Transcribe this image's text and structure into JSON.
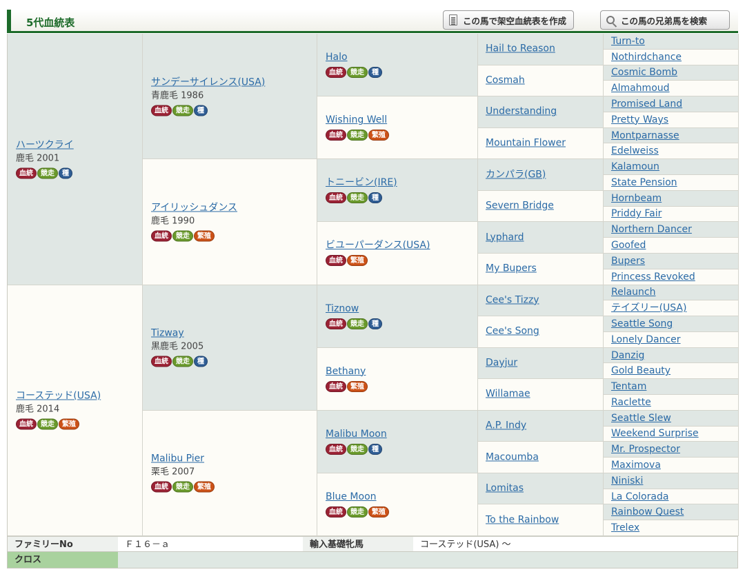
{
  "header": {
    "title": "5代血統表",
    "btn_fictional": "この馬で架空血統表を作成",
    "btn_siblings": "この馬の兄弟馬を検索"
  },
  "badges": {
    "blood": "血統",
    "race": "競走",
    "sire": "種",
    "mare": "繁殖"
  },
  "pedigree": {
    "g1": [
      {
        "name": "ハーツクライ",
        "detail": "鹿毛 2001",
        "badges": [
          "blood",
          "race",
          "sire"
        ]
      },
      {
        "name": "コーステッド(USA)",
        "detail": "鹿毛 2014",
        "badges": [
          "blood",
          "race",
          "mare"
        ]
      }
    ],
    "g2": [
      {
        "name": "サンデーサイレンス(USA)",
        "detail": "青鹿毛 1986",
        "badges": [
          "blood",
          "race",
          "sire"
        ]
      },
      {
        "name": "アイリッシュダンス",
        "detail": "鹿毛 1990",
        "badges": [
          "blood",
          "race",
          "mare"
        ]
      },
      {
        "name": "Tizway",
        "detail": "黒鹿毛 2005",
        "badges": [
          "blood",
          "race",
          "sire"
        ]
      },
      {
        "name": "Malibu Pier",
        "detail": "栗毛 2007",
        "badges": [
          "blood",
          "race",
          "mare"
        ]
      }
    ],
    "g3": [
      {
        "name": "Halo",
        "badges": [
          "blood",
          "race",
          "sire"
        ]
      },
      {
        "name": "Wishing Well",
        "badges": [
          "blood",
          "race",
          "mare"
        ]
      },
      {
        "name": "トニービン(IRE)",
        "badges": [
          "blood",
          "race",
          "sire"
        ]
      },
      {
        "name": "ビユーパーダンス(USA)",
        "badges": [
          "blood",
          "mare"
        ]
      },
      {
        "name": "Tiznow",
        "badges": [
          "blood",
          "race",
          "sire"
        ]
      },
      {
        "name": "Bethany",
        "badges": [
          "blood",
          "mare"
        ]
      },
      {
        "name": "Malibu Moon",
        "badges": [
          "blood",
          "race",
          "sire"
        ]
      },
      {
        "name": "Blue Moon",
        "badges": [
          "blood",
          "race",
          "mare"
        ]
      }
    ],
    "g4": [
      "Hail to Reason",
      "Cosmah",
      "Understanding",
      "Mountain Flower",
      "カンパラ(GB)",
      "Severn Bridge",
      "Lyphard",
      "My Bupers",
      "Cee's Tizzy",
      "Cee's Song",
      "Dayjur",
      "Willamae",
      "A.P. Indy",
      "Macoumba",
      "Lomitas",
      "To the Rainbow"
    ],
    "g5": [
      "Turn-to",
      "Nothirdchance",
      "Cosmic Bomb",
      "Almahmoud",
      "Promised Land",
      "Pretty Ways",
      "Montparnasse",
      "Edelweiss",
      "Kalamoun",
      "State Pension",
      "Hornbeam",
      "Priddy Fair",
      "Northern Dancer",
      "Goofed",
      "Bupers",
      "Princess Revoked",
      "Relaunch",
      "テイズリー(USA)",
      "Seattle Song",
      "Lonely Dancer",
      "Danzig",
      "Gold Beauty",
      "Tentam",
      "Raclette",
      "Seattle Slew",
      "Weekend Surprise",
      "Mr. Prospector",
      "Maximova",
      "Niniski",
      "La Colorada",
      "Rainbow Quest",
      "Trelex"
    ]
  },
  "footer": {
    "family_label": "ファミリーNo",
    "family_value": "Ｆ１６－ａ",
    "import_label": "輸入基礎牝馬",
    "import_value": "コーステッド(USA) ～",
    "cross_label": "クロス"
  }
}
